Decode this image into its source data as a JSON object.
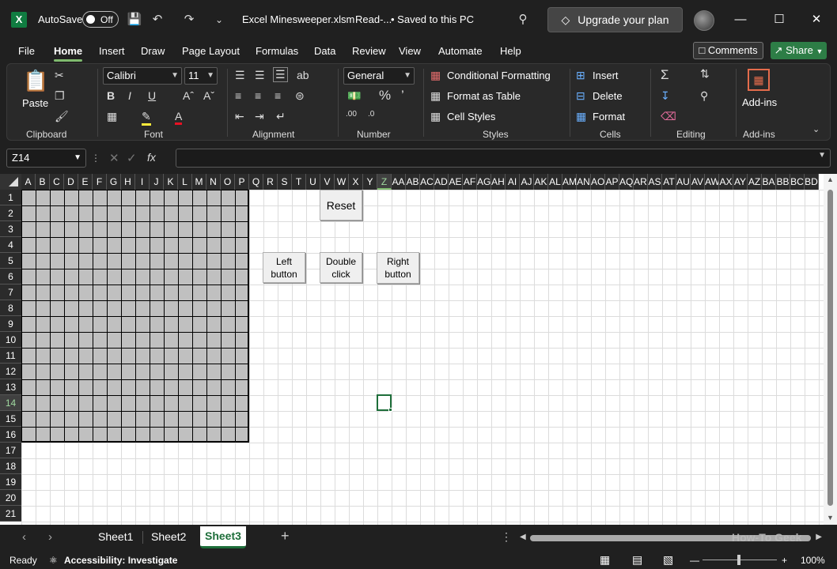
{
  "titlebar": {
    "autosave_label": "AutoSave",
    "autosave_state": "Off",
    "filename": "Excel Minesweeper.xlsm",
    "readonly": "Read-...",
    "save_status": "• Saved to this PC",
    "upgrade_label": "Upgrade your plan"
  },
  "menu": {
    "items": [
      "File",
      "Home",
      "Insert",
      "Draw",
      "Page Layout",
      "Formulas",
      "Data",
      "Review",
      "View",
      "Automate",
      "Help"
    ],
    "active": "Home",
    "comments_label": "Comments",
    "share_label": "Share"
  },
  "ribbon": {
    "clipboard": {
      "paste_label": "Paste",
      "group_label": "Clipboard"
    },
    "font": {
      "font_name": "Calibri",
      "font_size": "11",
      "group_label": "Font"
    },
    "alignment": {
      "group_label": "Alignment"
    },
    "number": {
      "format": "General",
      "group_label": "Number"
    },
    "styles": {
      "conditional": "Conditional Formatting",
      "format_table": "Format as Table",
      "cell_styles": "Cell Styles",
      "group_label": "Styles"
    },
    "cells": {
      "insert": "Insert",
      "delete": "Delete",
      "format": "Format",
      "group_label": "Cells"
    },
    "editing": {
      "group_label": "Editing"
    },
    "addins": {
      "label": "Add-ins",
      "group_label": "Add-ins"
    }
  },
  "formula_bar": {
    "name_box": "Z14",
    "fx_label": "fx",
    "formula": ""
  },
  "columns": [
    "A",
    "B",
    "C",
    "D",
    "E",
    "F",
    "G",
    "H",
    "I",
    "J",
    "K",
    "L",
    "M",
    "N",
    "O",
    "P",
    "Q",
    "R",
    "S",
    "T",
    "U",
    "V",
    "W",
    "X",
    "Y",
    "Z",
    "AA",
    "AB",
    "AC",
    "AD",
    "AE",
    "AF",
    "AG",
    "AH",
    "AI",
    "AJ",
    "AK",
    "AL",
    "AM",
    "AN",
    "AO",
    "AP",
    "AQ",
    "AR",
    "AS",
    "AT",
    "AU",
    "AV",
    "AW",
    "AX",
    "AY",
    "AZ",
    "BA",
    "BB",
    "BC",
    "BD"
  ],
  "selected_column": "Z",
  "rows": [
    "1",
    "2",
    "3",
    "4",
    "5",
    "6",
    "7",
    "8",
    "9",
    "10",
    "11",
    "12",
    "13",
    "14",
    "15",
    "16",
    "17",
    "18",
    "19",
    "20",
    "21"
  ],
  "selected_row": "14",
  "buttons": {
    "reset": "Reset",
    "left_line1": "Left",
    "left_line2": "button",
    "double_line1": "Double",
    "double_line2": "click",
    "right_line1": "Right",
    "right_line2": "button"
  },
  "sheets": [
    "Sheet1",
    "Sheet2",
    "Sheet3"
  ],
  "active_sheet": "Sheet3",
  "status": {
    "ready": "Ready",
    "accessibility": "Accessibility: Investigate",
    "zoom": "100%"
  },
  "watermark": "How-To Geek",
  "icons": [
    "excel-logo",
    "save-icon",
    "undo-icon",
    "redo-icon",
    "search-icon",
    "diamond-icon",
    "minimize-icon",
    "maximize-icon",
    "close-icon"
  ]
}
